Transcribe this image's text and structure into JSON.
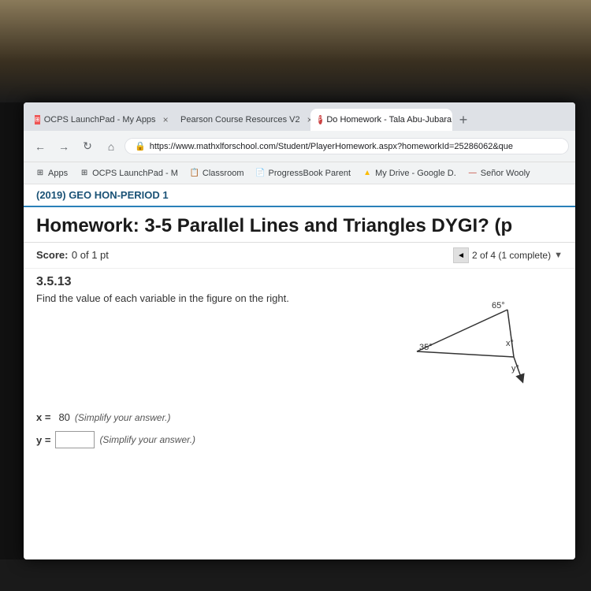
{
  "background": {
    "color": "#1a1a1a"
  },
  "browser": {
    "tabs": [
      {
        "id": "tab-ocps",
        "label": "OCPS LaunchPad - My Apps",
        "favicon": "ocps",
        "active": false,
        "closable": true
      },
      {
        "id": "tab-pearson",
        "label": "Pearson Course Resources V2",
        "favicon": "pearson",
        "active": false,
        "closable": true
      },
      {
        "id": "tab-mathxl",
        "label": "Do Homework - Tala Abu-Jubara",
        "favicon": "mathxl",
        "active": true,
        "closable": true
      }
    ],
    "new_tab_label": "+",
    "nav": {
      "back": "←",
      "forward": "→",
      "refresh": "↻",
      "home": "⌂"
    },
    "address": "https://www.mathxlforschool.com/Student/PlayerHomework.aspx?homeworkId=25286062&que",
    "lock_icon": "🔒"
  },
  "bookmarks": [
    {
      "id": "bm-apps",
      "label": "Apps",
      "icon": "⊞"
    },
    {
      "id": "bm-ocps",
      "label": "OCPS LaunchPad - M",
      "icon": "⊞"
    },
    {
      "id": "bm-classroom",
      "label": "Classroom",
      "icon": "📋"
    },
    {
      "id": "bm-progressbook",
      "label": "ProgressBook Parent",
      "icon": "📄"
    },
    {
      "id": "bm-drive",
      "label": "My Drive - Google D.",
      "icon": "▲"
    },
    {
      "id": "bm-senor",
      "label": "Señor Wooly",
      "icon": "🌐"
    }
  ],
  "page": {
    "period_header": "(2019) GEO HON-PERIOD 1",
    "homework_title": "Homework: 3-5 Parallel Lines and Triangles DYGI? (p",
    "score_label": "Score:",
    "score_value": "0 of 1 pt",
    "progress_text": "2 of 4 (1 complete)",
    "progress_dropdown": "▼",
    "arrow_left": "◄",
    "problem_number": "3.5.13",
    "problem_instruction": "Find the value of each variable in the figure on the right.",
    "figure": {
      "angle_top": "65°",
      "angle_left": "35°",
      "angle_x": "x°",
      "angle_y": "y°"
    },
    "answers": [
      {
        "id": "answer-x",
        "variable": "x =",
        "value": "80",
        "note": "(Simplify your answer.)"
      },
      {
        "id": "answer-y",
        "variable": "y =",
        "value": "",
        "placeholder": "",
        "note": "(Simplify your answer.)"
      }
    ]
  }
}
